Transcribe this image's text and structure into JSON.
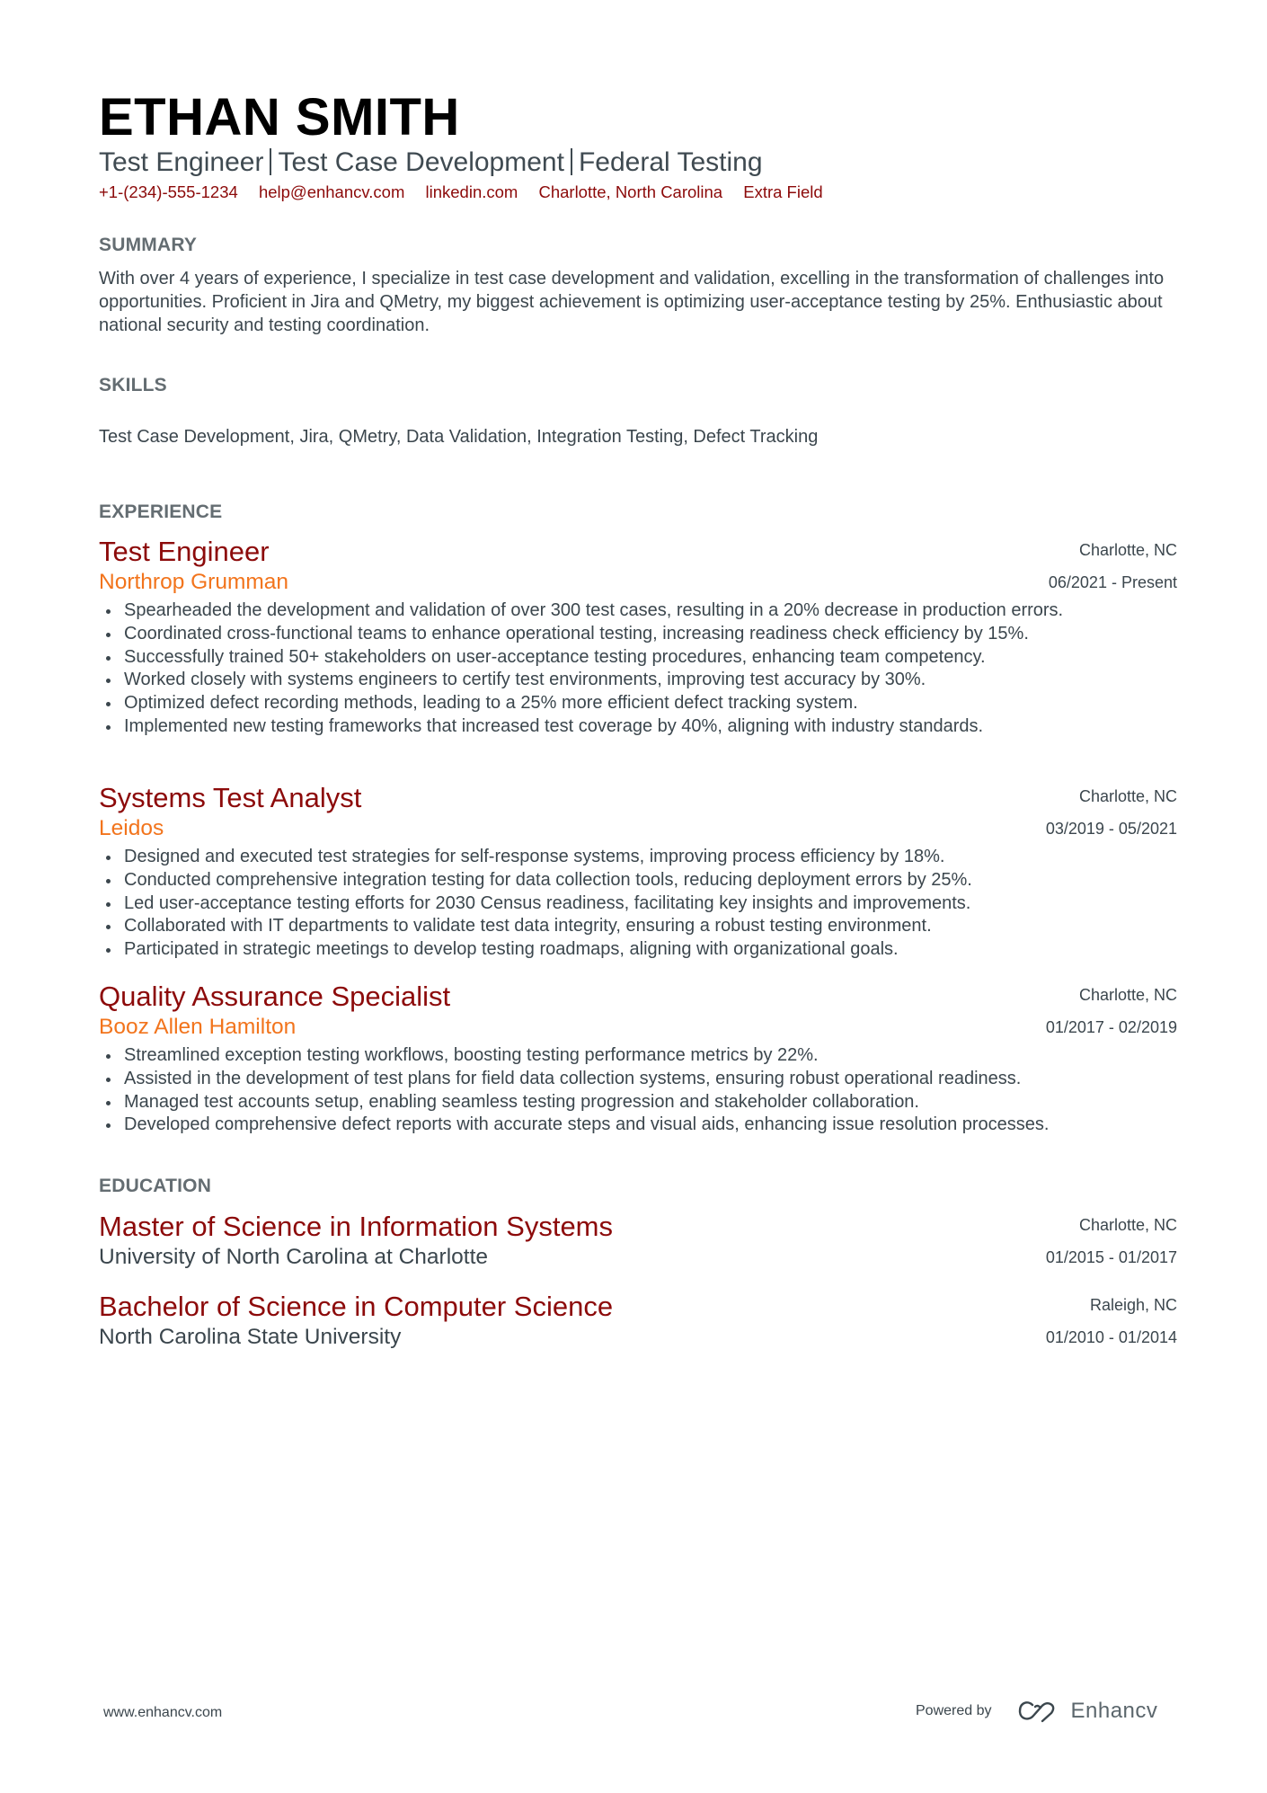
{
  "header": {
    "name": "ETHAN SMITH",
    "subtitle_parts": [
      "Test Engineer",
      "Test Case Development",
      "Federal Testing"
    ],
    "contacts": [
      "+1-(234)-555-1234",
      "help@enhancv.com",
      "linkedin.com",
      "Charlotte, North Carolina",
      "Extra Field"
    ]
  },
  "summary": {
    "heading": "SUMMARY",
    "text": "With over 4 years of experience, I specialize in test case development and validation, excelling in the transformation of challenges into opportunities. Proficient in Jira and QMetry, my biggest achievement is optimizing user-acceptance testing by 25%. Enthusiastic about national security and testing coordination."
  },
  "skills": {
    "heading": "SKILLS",
    "text": "Test Case Development, Jira, QMetry, Data Validation, Integration Testing, Defect Tracking"
  },
  "experience": {
    "heading": "EXPERIENCE",
    "items": [
      {
        "title": "Test Engineer",
        "company": "Northrop Grumman",
        "location": "Charlotte, NC",
        "dates": "06/2021 - Present",
        "bullets": [
          "Spearheaded the development and validation of over 300 test cases, resulting in a 20% decrease in production errors.",
          "Coordinated cross-functional teams to enhance operational testing, increasing readiness check efficiency by 15%.",
          "Successfully trained 50+ stakeholders on user-acceptance testing procedures, enhancing team competency.",
          "Worked closely with systems engineers to certify test environments, improving test accuracy by 30%.",
          "Optimized defect recording methods, leading to a 25% more efficient defect tracking system.",
          "Implemented new testing frameworks that increased test coverage by 40%, aligning with industry standards."
        ]
      },
      {
        "title": "Systems Test Analyst",
        "company": "Leidos",
        "location": "Charlotte, NC",
        "dates": "03/2019 - 05/2021",
        "bullets": [
          "Designed and executed test strategies for self-response systems, improving process efficiency by 18%.",
          "Conducted comprehensive integration testing for data collection tools, reducing deployment errors by 25%.",
          "Led user-acceptance testing efforts for 2030 Census readiness, facilitating key insights and improvements.",
          "Collaborated with IT departments to validate test data integrity, ensuring a robust testing environment.",
          "Participated in strategic meetings to develop testing roadmaps, aligning with organizational goals."
        ]
      },
      {
        "title": "Quality Assurance Specialist",
        "company": "Booz Allen Hamilton",
        "location": "Charlotte, NC",
        "dates": "01/2017 - 02/2019",
        "bullets": [
          "Streamlined exception testing workflows, boosting testing performance metrics by 22%.",
          "Assisted in the development of test plans for field data collection systems, ensuring robust operational readiness.",
          "Managed test accounts setup, enabling seamless testing progression and stakeholder collaboration.",
          "Developed comprehensive defect reports with accurate steps and visual aids, enhancing issue resolution processes."
        ]
      }
    ]
  },
  "education": {
    "heading": "EDUCATION",
    "items": [
      {
        "degree": "Master of Science in Information Systems",
        "school": "University of North Carolina at Charlotte",
        "location": "Charlotte, NC",
        "dates": "01/2015 - 01/2017"
      },
      {
        "degree": "Bachelor of Science in Computer Science",
        "school": "North Carolina State University",
        "location": "Raleigh, NC",
        "dates": "01/2010 - 01/2014"
      }
    ]
  },
  "footer": {
    "website": "www.enhancv.com",
    "powered_by": "Powered by",
    "brand": "Enhancv",
    "brand_icon": "enhancv-logo-icon"
  },
  "colors": {
    "name": "#000000",
    "accent_title": "#8c0a0a",
    "accent_company": "#f2741c",
    "section_heading": "#646d72",
    "body_text": "#3b464d"
  }
}
